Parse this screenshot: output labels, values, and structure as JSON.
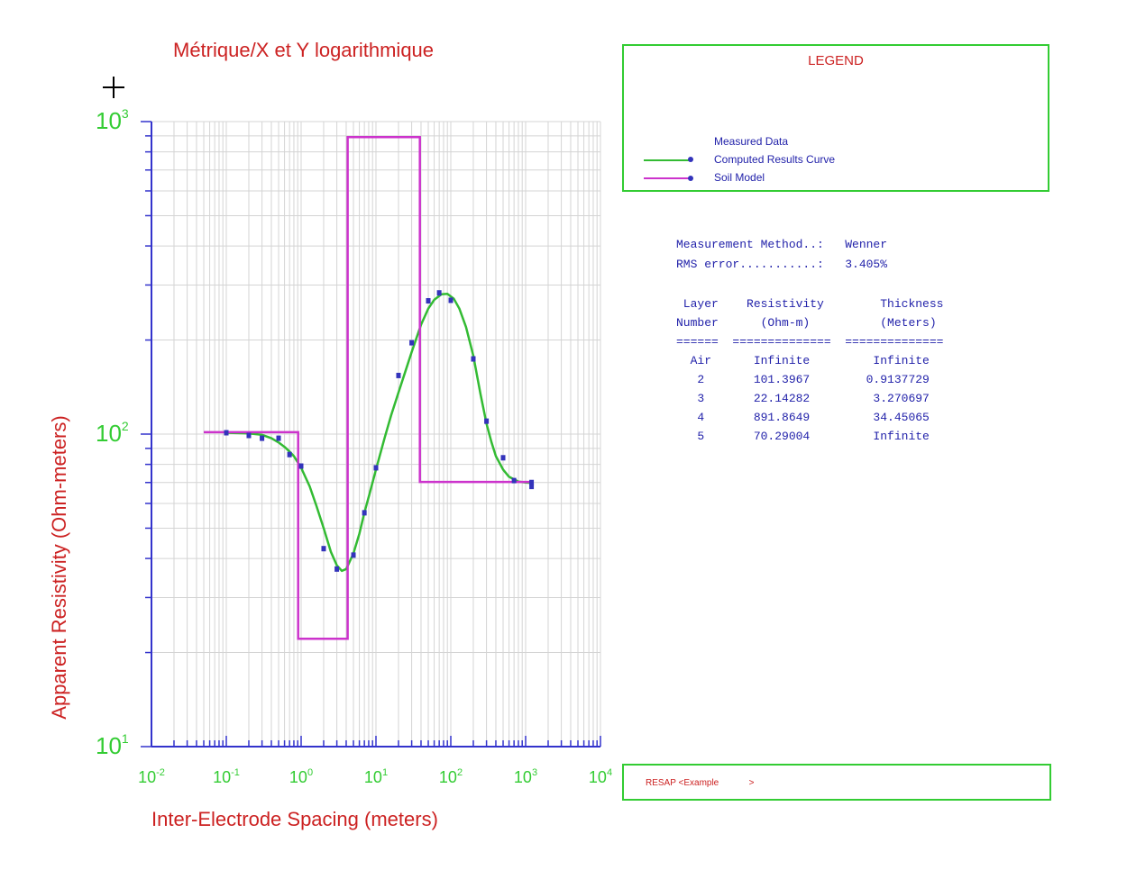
{
  "title": "Métrique/X et Y logarithmique",
  "colors": {
    "axis": "#3333cc",
    "grid": "#d4d4d4",
    "tick_label": "#33cc33",
    "axis_title": "#cc2222",
    "measured": "#3333bb",
    "curve": "#33bb33",
    "soil_model": "#cc33cc"
  },
  "chart_data": {
    "type": "line",
    "title": "Métrique/X et Y logarithmique",
    "xlabel": "Inter-Electrode Spacing (meters)",
    "ylabel": "Apparent Resistivity (Ohm-meters)",
    "x_scale": "log",
    "y_scale": "log",
    "xlim": [
      0.01,
      10000
    ],
    "ylim": [
      10,
      1000
    ],
    "grid": true,
    "legend_placement": "right",
    "x_ticks": [
      {
        "base": "10",
        "exp": "-2"
      },
      {
        "base": "10",
        "exp": "-1"
      },
      {
        "base": "10",
        "exp": "0"
      },
      {
        "base": "10",
        "exp": "1"
      },
      {
        "base": "10",
        "exp": "2"
      },
      {
        "base": "10",
        "exp": "3"
      },
      {
        "base": "10",
        "exp": "4"
      }
    ],
    "y_ticks": [
      {
        "base": "10",
        "exp": "1"
      },
      {
        "base": "10",
        "exp": "2"
      },
      {
        "base": "10",
        "exp": "3"
      }
    ],
    "series": [
      {
        "name": "Measured Data",
        "kind": "scatter",
        "x": [
          0.1,
          0.2,
          0.3,
          0.5,
          0.7,
          1,
          2,
          3,
          5,
          7,
          10,
          20,
          30,
          50,
          70,
          100,
          200,
          300,
          500,
          700,
          1200,
          1200
        ],
        "y": [
          101,
          99,
          97,
          97,
          86,
          79,
          43,
          37,
          41,
          56,
          78,
          154,
          196,
          267,
          283,
          268,
          174,
          110,
          84,
          71,
          70,
          68
        ]
      },
      {
        "name": "Computed Results Curve",
        "kind": "line",
        "x": [
          0.1,
          0.2,
          0.3,
          0.4,
          0.5,
          0.6,
          0.7,
          0.8,
          1.0,
          1.3,
          1.6,
          2.0,
          2.5,
          3.0,
          3.5,
          4.0,
          5.0,
          6.0,
          7.0,
          8.0,
          10,
          13,
          16,
          20,
          25,
          30,
          40,
          50,
          60,
          75,
          90,
          110,
          130,
          160,
          200,
          250,
          300,
          350,
          400,
          500,
          600,
          800,
          1000,
          1200
        ],
        "y": [
          101,
          100.5,
          99.5,
          97,
          94,
          91,
          88,
          85,
          78,
          68,
          59,
          50,
          42,
          38,
          36.5,
          37,
          41.5,
          48,
          56,
          63,
          77,
          97,
          115,
          136,
          160,
          183,
          224,
          252,
          269,
          280,
          281,
          271,
          252,
          220,
          178,
          134,
          108,
          94,
          85,
          77,
          73,
          70.5,
          70,
          69.8
        ]
      },
      {
        "name": "Soil Model",
        "kind": "step",
        "x": [
          0.05,
          0.9137729,
          0.9137729,
          4.184467,
          4.184467,
          38.63512,
          38.63512,
          1200
        ],
        "y": [
          101.3967,
          101.3967,
          22.14282,
          22.14282,
          891.8649,
          891.8649,
          70.29004,
          70.29004
        ]
      }
    ]
  },
  "legend": {
    "title": "LEGEND",
    "items": [
      {
        "label": "Measured Data"
      },
      {
        "label": "Computed Results Curve"
      },
      {
        "label": "Soil Model"
      }
    ]
  },
  "results": {
    "method_line": "Measurement Method..:   Wenner",
    "rms_line": "RMS error...........:   3.405%",
    "header1": " Layer    Resistivity        Thickness",
    "header2": "Number      (Ohm-m)          (Meters)",
    "sep": "======  ==============  ==============",
    "rows": [
      "  Air      Infinite         Infinite",
      "   2       101.3967        0.9137729",
      "   3       22.14282         3.270697",
      "   4       891.8649         34.45065",
      "   5       70.29004         Infinite"
    ]
  },
  "footer": {
    "text": "RESAP <Example            >"
  }
}
